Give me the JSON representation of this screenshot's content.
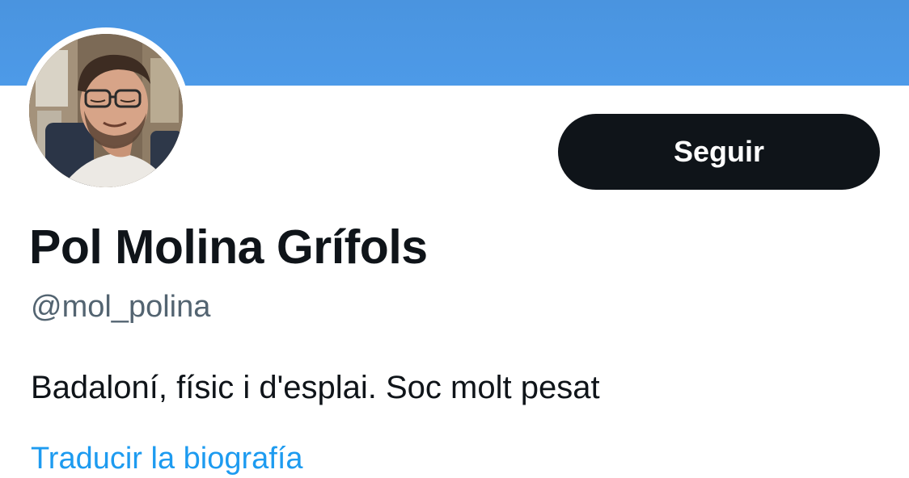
{
  "profile": {
    "display_name": "Pol Molina Grífols",
    "handle": "@mol_polina",
    "bio": "Badaloní, físic i d'esplai. Soc molt pesat",
    "translate_bio_label": "Traducir la biografía"
  },
  "actions": {
    "follow_label": "Seguir"
  },
  "colors": {
    "banner": "#4d9ae8",
    "follow_button_bg": "#0f1419",
    "handle_text": "#536471",
    "link": "#1d9bf0"
  },
  "icons": {
    "avatar": "profile-photo"
  }
}
